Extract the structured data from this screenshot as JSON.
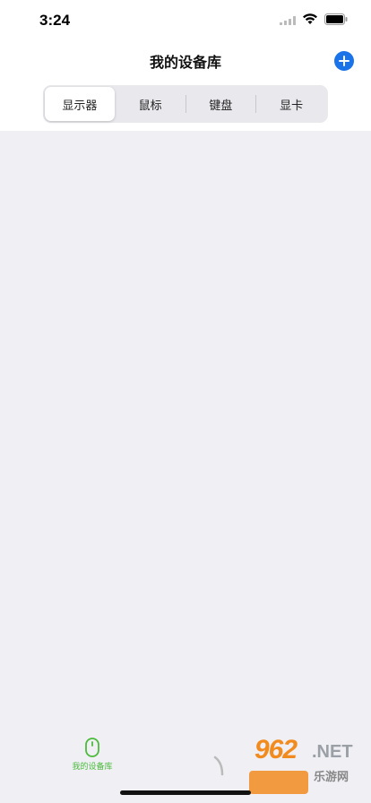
{
  "status_bar": {
    "time": "3:24"
  },
  "nav": {
    "title": "我的设备库",
    "add_icon": "plus-circle-icon",
    "accent_color": "#1a73e8"
  },
  "segments": [
    {
      "label": "显示器",
      "selected": true
    },
    {
      "label": "鼠标",
      "selected": false
    },
    {
      "label": "键盘",
      "selected": false
    },
    {
      "label": "显卡",
      "selected": false
    }
  ],
  "tabbar": {
    "items": [
      {
        "label": "我的设备库",
        "icon": "mouse-icon",
        "active": true,
        "color": "#4cbb3c"
      }
    ]
  },
  "watermark": {
    "number": "962",
    "suffix": ".NET",
    "chinese": "乐游网"
  }
}
